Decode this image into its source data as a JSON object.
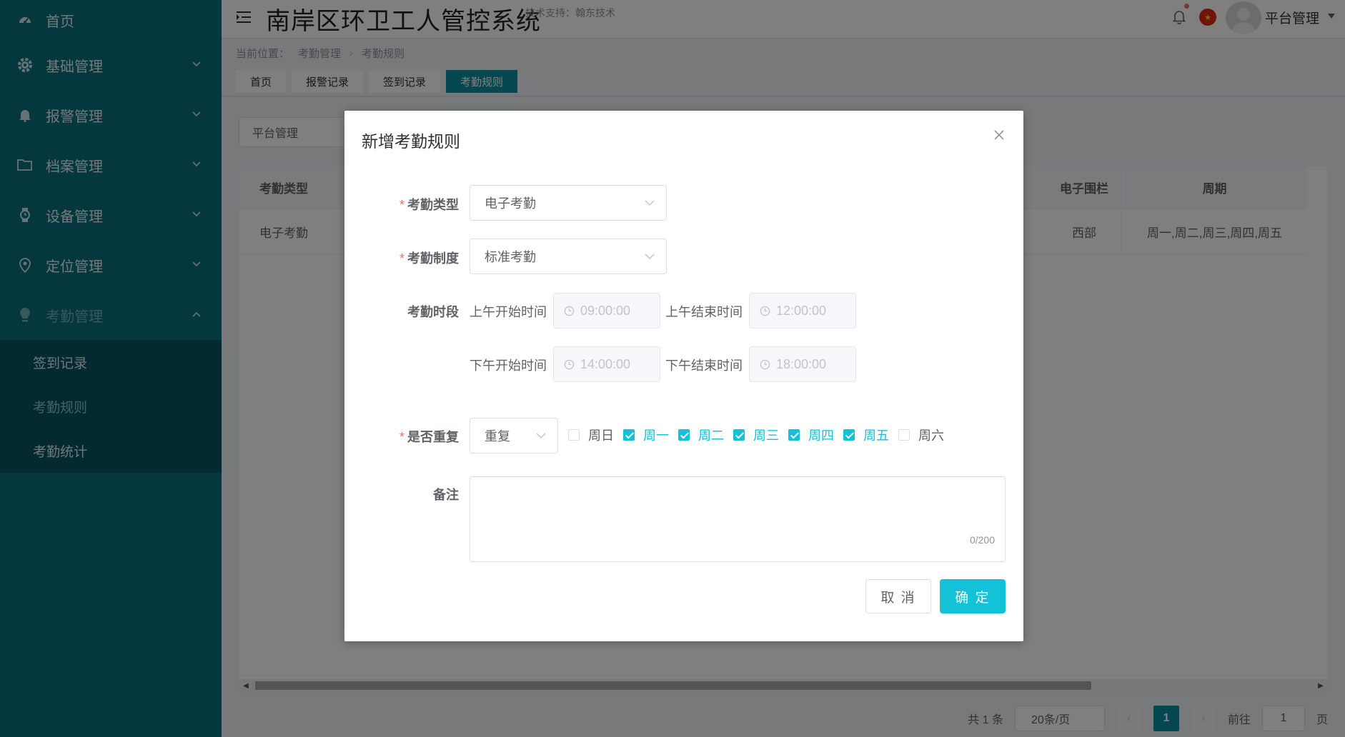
{
  "sidebar": {
    "items": [
      {
        "label": "首页",
        "icon": "dashboard-icon"
      },
      {
        "label": "基础管理",
        "icon": "gear-icon"
      },
      {
        "label": "报警管理",
        "icon": "bell-icon"
      },
      {
        "label": "档案管理",
        "icon": "folder-icon"
      },
      {
        "label": "设备管理",
        "icon": "watch-icon"
      },
      {
        "label": "定位管理",
        "icon": "location-icon"
      },
      {
        "label": "考勤管理",
        "icon": "bulb-icon"
      }
    ],
    "sub_items": [
      {
        "label": "签到记录"
      },
      {
        "label": "考勤规则"
      },
      {
        "label": "考勤统计"
      }
    ]
  },
  "header": {
    "title": "南岸区环卫工人管控系统",
    "subtitle": "技术支持：翰东技术",
    "user": "平台管理"
  },
  "breadcrumb": {
    "prefix": "当前位置：",
    "level1": "考勤管理",
    "level2": "考勤规则"
  },
  "tabs": [
    {
      "label": "首页"
    },
    {
      "label": "报警记录"
    },
    {
      "label": "签到记录"
    },
    {
      "label": "考勤规则"
    }
  ],
  "filter": {
    "value": "平台管理"
  },
  "table": {
    "headers": {
      "type": "考勤类型",
      "fence": "电子围栏",
      "period": "周期"
    },
    "row": {
      "type": "电子考勤",
      "fence": "西部",
      "period": "周一,周二,周三,周四,周五"
    }
  },
  "pager": {
    "total": "共 1 条",
    "page_size": "20条/页",
    "current": "1",
    "goto_label": "前往",
    "goto_value": "1",
    "page_unit": "页"
  },
  "modal": {
    "title": "新增考勤规则",
    "type_label": "考勤类型",
    "type_value": "电子考勤",
    "system_label": "考勤制度",
    "system_value": "标准考勤",
    "period_label": "考勤时段",
    "am_start_label": "上午开始时间",
    "am_start": "09:00:00",
    "am_end_label": "上午结束时间",
    "am_end": "12:00:00",
    "pm_start_label": "下午开始时间",
    "pm_start": "14:00:00",
    "pm_end_label": "下午结束时间",
    "pm_end": "18:00:00",
    "repeat_label": "是否重复",
    "repeat_value": "重复",
    "days": [
      {
        "label": "周日",
        "checked": false
      },
      {
        "label": "周一",
        "checked": true
      },
      {
        "label": "周二",
        "checked": true
      },
      {
        "label": "周三",
        "checked": true
      },
      {
        "label": "周四",
        "checked": true
      },
      {
        "label": "周五",
        "checked": true
      },
      {
        "label": "周六",
        "checked": false
      }
    ],
    "remark_label": "备注",
    "remark_count": "0/200",
    "cancel": "取 消",
    "confirm": "确 定"
  },
  "colors": {
    "sidebar": "#0a6e7e",
    "accent": "#13c2d6",
    "tab_active": "#0a8ea0"
  }
}
